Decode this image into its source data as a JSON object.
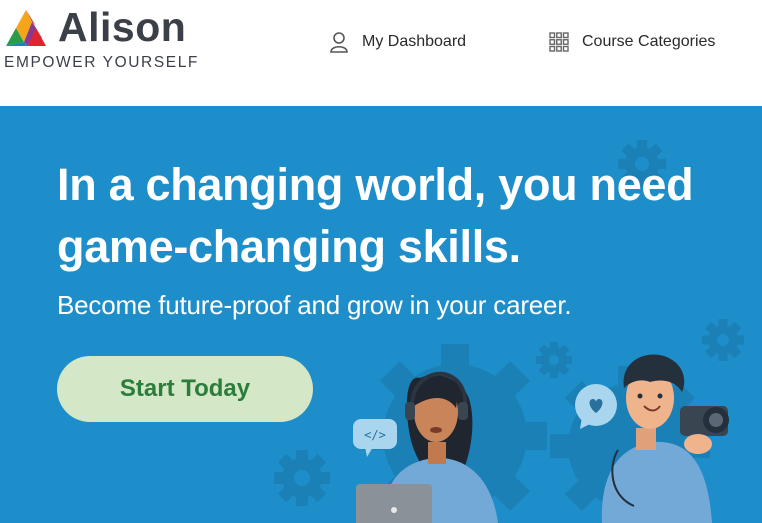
{
  "brand": {
    "name": "Alison",
    "tagline": "EMPOWER YOURSELF"
  },
  "nav": {
    "dashboard_label": "My Dashboard",
    "categories_label": "Course Categories"
  },
  "hero": {
    "title": "In a changing world, you need game-changing skills.",
    "subtitle": "Become future-proof and grow in your career.",
    "cta_label": "Start Today"
  },
  "icons": {
    "dashboard": "user-icon",
    "categories": "grid-icon",
    "code_bubble": "</>"
  },
  "colors": {
    "hero_bg": "#1d8ec9",
    "cta_bg": "#d4e7c6",
    "cta_text": "#2c7d3b",
    "brand_text": "#3a3f48"
  }
}
